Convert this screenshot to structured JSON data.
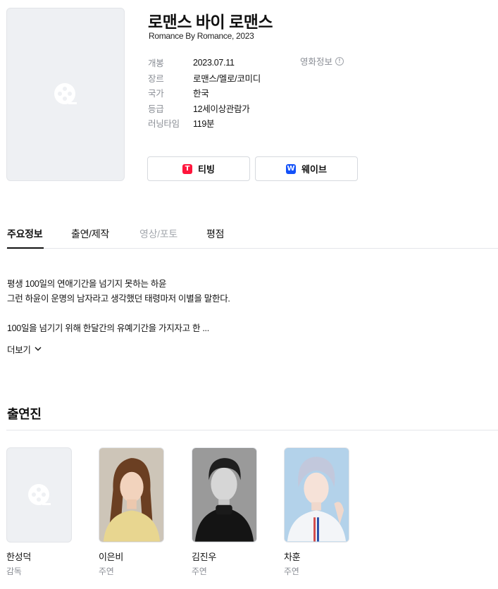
{
  "movie": {
    "title": "로맨스 바이 로맨스",
    "subtitle": "Romance By Romance, 2023",
    "info": [
      {
        "key": "개봉",
        "value": "2023.07.11"
      },
      {
        "key": "장르",
        "value": "로맨스/멜로/코미디"
      },
      {
        "key": "국가",
        "value": "한국"
      },
      {
        "key": "등급",
        "value": "12세이상관람가"
      },
      {
        "key": "러닝타임",
        "value": "119분"
      }
    ],
    "movie_info_label": "영화정보",
    "info_icon_glyph": "!",
    "poster_icon": "film-reel-icon"
  },
  "ott": {
    "tving": {
      "label": "티빙",
      "logo_glyph": "T",
      "color": "#ff153c"
    },
    "wavve": {
      "label": "웨이브",
      "logo_glyph": "W",
      "color": "#1351f9"
    }
  },
  "tabs": [
    {
      "label": "주요정보",
      "active": true
    },
    {
      "label": "출연/제작",
      "active": false
    },
    {
      "label": "영상/포토",
      "disabled": true
    },
    {
      "label": "평점",
      "active": false
    }
  ],
  "synopsis": {
    "lines": [
      "평생 100일의 연애기간을 넘기지 못하는 하윤",
      "그런 하윤이 운명의 남자라고 생각했던 태령마저 이별을 말한다.",
      "100일을 넘기기 위해 한달간의 유예기간을 가지자고 한 ..."
    ],
    "more_label": "더보기"
  },
  "cast": {
    "heading": "출연진",
    "members": [
      {
        "name": "한성덕",
        "role": "감독",
        "photo": "placeholder"
      },
      {
        "name": "이은비",
        "role": "주연",
        "photo": "portrait"
      },
      {
        "name": "김진우",
        "role": "주연",
        "photo": "portrait"
      },
      {
        "name": "차훈",
        "role": "주연",
        "photo": "portrait"
      }
    ]
  },
  "colors": {
    "text": "#111111",
    "muted": "#8a8e95",
    "border": "#e4e6ea",
    "placeholder_bg": "#eef0f3"
  }
}
